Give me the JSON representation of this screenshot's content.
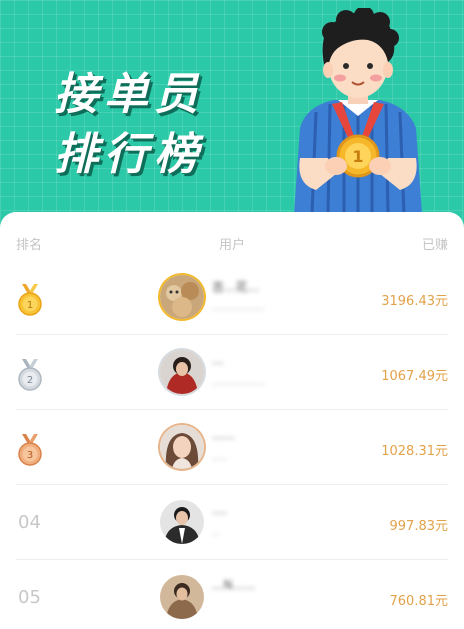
{
  "banner": {
    "title_line1": "接单员",
    "title_line2": "排行榜",
    "bg_color": "#2cc9a8",
    "mascot_icon": "person-holding-gold-medal",
    "mascot_medal_text": "1"
  },
  "table": {
    "headers": {
      "rank": "排名",
      "user": "用户",
      "earned": "已赚"
    },
    "rows": [
      {
        "rank": "1",
        "medal_label": "1",
        "medal": "gold-medal",
        "name": "吉...花...",
        "sub": "...............",
        "amount": "3196.43元"
      },
      {
        "rank": "2",
        "medal_label": "2",
        "medal": "silver-medal",
        "name": "...",
        "sub": "...............",
        "amount": "1067.49元"
      },
      {
        "rank": "3",
        "medal_label": "3",
        "medal": "bronze-medal",
        "name": "......",
        "sub": "....",
        "amount": "1028.31元"
      },
      {
        "rank": "04",
        "name": "....",
        "sub": "..",
        "amount": "997.83元"
      },
      {
        "rank": "05",
        "name": "...N......",
        "sub": "",
        "amount": "760.81元"
      }
    ]
  }
}
